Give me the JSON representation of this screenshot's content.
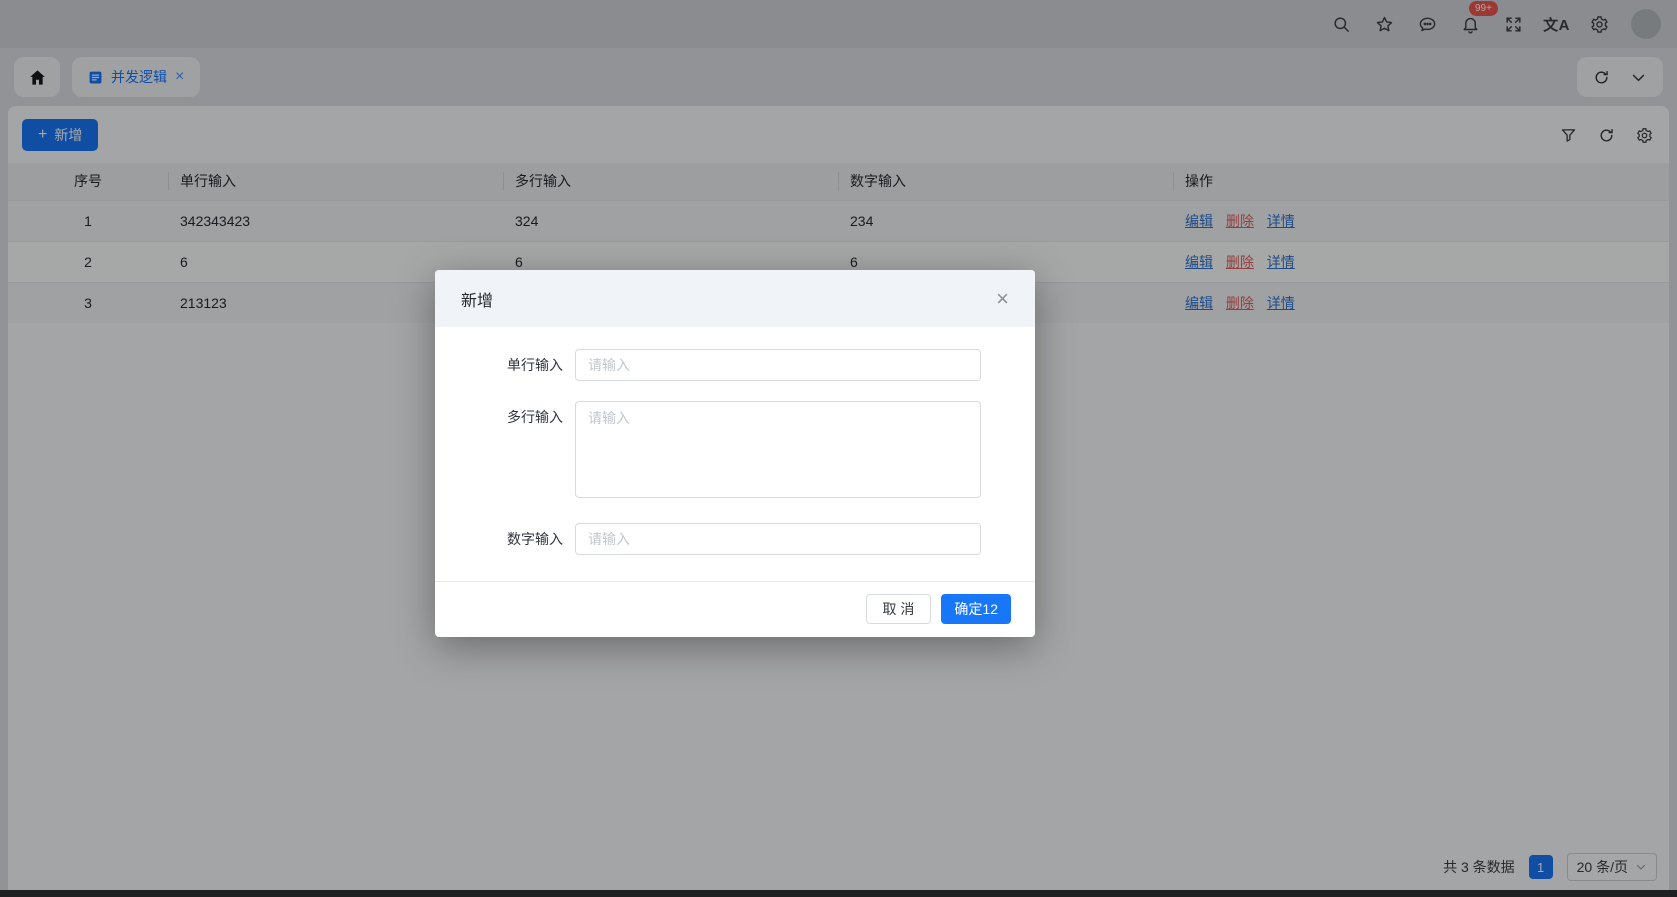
{
  "navbar": {
    "badge": "99+",
    "translate_glyph": "文A"
  },
  "tabbar": {
    "tab": {
      "label": "并发逻辑",
      "close": "×"
    }
  },
  "toolbar": {
    "add_plus": "+",
    "add_label": "新增"
  },
  "table": {
    "headers": [
      "序号",
      "单行输入",
      "多行输入",
      "数字输入",
      "操作"
    ],
    "rows": [
      {
        "cells": [
          "1",
          "342343423",
          "324",
          "234"
        ]
      },
      {
        "cells": [
          "2",
          "6",
          "6",
          "6"
        ]
      },
      {
        "cells": [
          "3",
          "213123",
          "",
          ""
        ]
      }
    ],
    "actions": {
      "edit": "编辑",
      "remove": "删除",
      "detail": "详情"
    }
  },
  "pagination": {
    "total": "共 3 条数据",
    "current_page": "1",
    "page_size": "20 条/页"
  },
  "modal": {
    "title": "新增",
    "close": "×",
    "fields": [
      {
        "label": "单行输入",
        "placeholder": "请输入"
      },
      {
        "label": "多行输入",
        "placeholder": "请输入"
      },
      {
        "label": "数字输入",
        "placeholder": "请输入"
      }
    ],
    "cancel_label": "取 消",
    "ok_label": "确定12"
  },
  "colors": {
    "primary": "#1777f8",
    "link": "#2f74d0",
    "danger": "#e25f5f",
    "badge": "#ef564f",
    "modal_header_bg": "#f0f3f7"
  }
}
